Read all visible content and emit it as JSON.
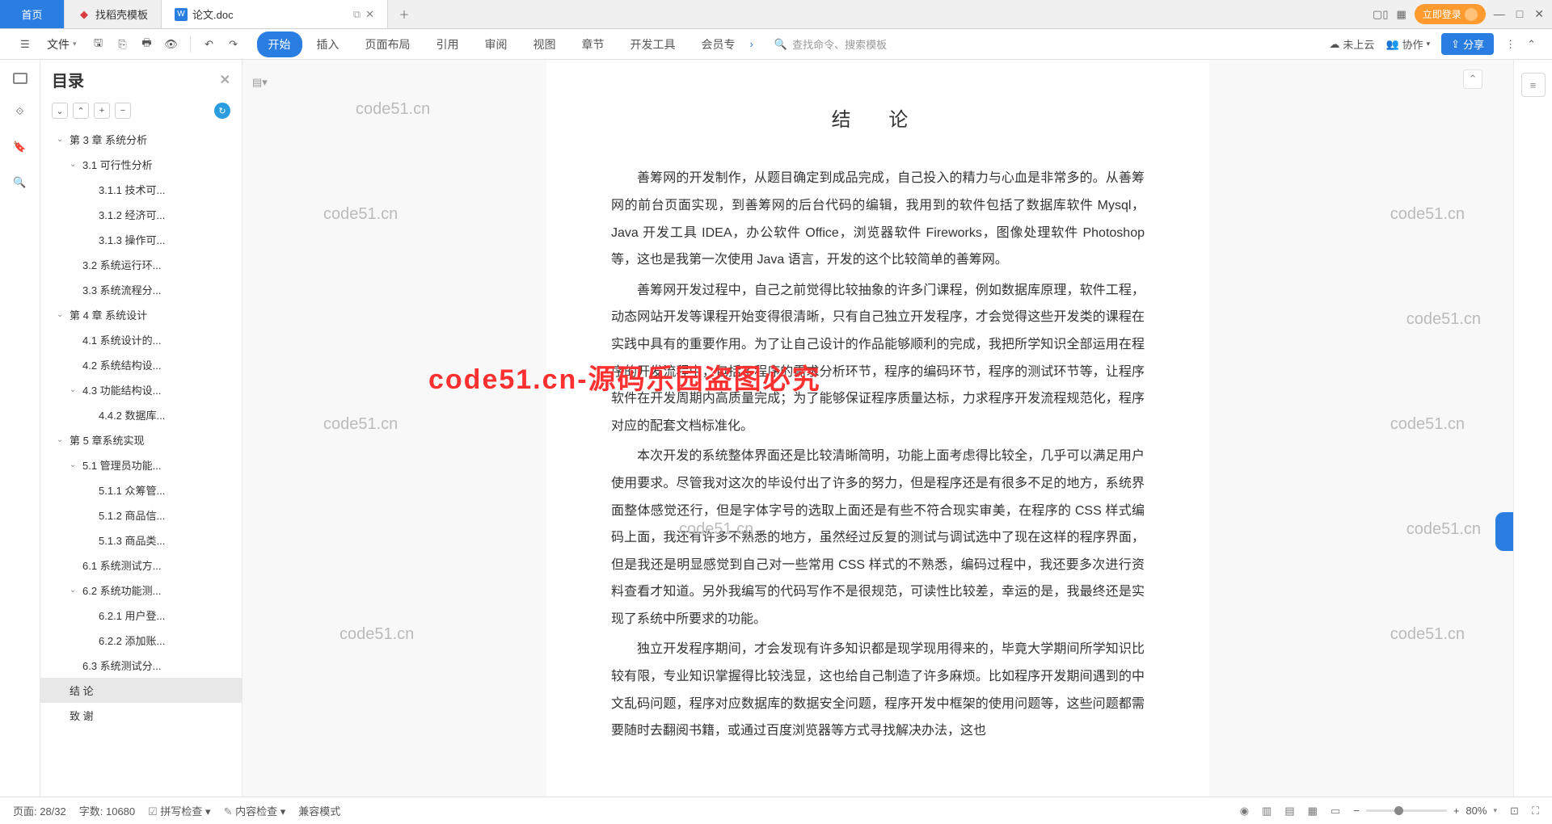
{
  "tabs": {
    "home": "首页",
    "t1": "找稻壳模板",
    "t2": "论文.doc"
  },
  "login": "立即登录",
  "file_menu": "文件",
  "ribbon_tabs": [
    "开始",
    "插入",
    "页面布局",
    "引用",
    "审阅",
    "视图",
    "章节",
    "开发工具",
    "会员专"
  ],
  "search_placeholder": "查找命令、搜索模板",
  "cloud_status": "未上云",
  "collab": "协作",
  "share": "分享",
  "toc": {
    "title": "目录",
    "items": [
      {
        "t": "第 3 章 系统分析",
        "ind": 1,
        "chev": "v"
      },
      {
        "t": "3.1 可行性分析",
        "ind": 2,
        "chev": "v"
      },
      {
        "t": "3.1.1 技术可...",
        "ind": 3
      },
      {
        "t": "3.1.2 经济可...",
        "ind": 3
      },
      {
        "t": "3.1.3 操作可...",
        "ind": 3
      },
      {
        "t": "3.2 系统运行环...",
        "ind": 2
      },
      {
        "t": "3.3 系统流程分...",
        "ind": 2
      },
      {
        "t": "第 4 章  系统设计",
        "ind": 1,
        "chev": "v"
      },
      {
        "t": "4.1 系统设计的...",
        "ind": 2
      },
      {
        "t": "4.2 系统结构设...",
        "ind": 2
      },
      {
        "t": "4.3 功能结构设...",
        "ind": 2,
        "chev": "v"
      },
      {
        "t": "4.4.2 数据库...",
        "ind": 3
      },
      {
        "t": "第 5 章系统实现",
        "ind": 1,
        "chev": "v"
      },
      {
        "t": "5.1 管理员功能...",
        "ind": 2,
        "chev": "v"
      },
      {
        "t": "5.1.1 众筹管...",
        "ind": 3
      },
      {
        "t": "5.1.2 商品信...",
        "ind": 3
      },
      {
        "t": "5.1.3 商品类...",
        "ind": 3
      },
      {
        "t": "6.1 系统测试方...",
        "ind": 2
      },
      {
        "t": "6.2 系统功能测...",
        "ind": 2,
        "chev": "v"
      },
      {
        "t": "6.2.1 用户登...",
        "ind": 3
      },
      {
        "t": "6.2.2 添加账...",
        "ind": 3
      },
      {
        "t": "6.3 系统测试分...",
        "ind": 2
      },
      {
        "t": "结  论",
        "ind": 1,
        "sel": true
      },
      {
        "t": "致  谢",
        "ind": 1
      }
    ]
  },
  "doc": {
    "title": "结    论",
    "p1": "善筹网的开发制作，从题目确定到成品完成，自己投入的精力与心血是非常多的。从善筹网的前台页面实现，到善筹网的后台代码的编辑，我用到的软件包括了数据库软件 Mysql，Java 开发工具 IDEA，办公软件 Office，浏览器软件 Fireworks，图像处理软件 Photoshop 等，这也是我第一次使用 Java 语言，开发的这个比较简单的善筹网。",
    "p2": "善筹网开发过程中，自己之前觉得比较抽象的许多门课程，例如数据库原理，软件工程，动态网站开发等课程开始变得很清晰，只有自己独立开发程序，才会觉得这些开发类的课程在实践中具有的重要作用。为了让自己设计的作品能够顺利的完成，我把所学知识全部运用在程序的开发流程中，包括了程序的需求分析环节，程序的编码环节，程序的测试环节等，让程序软件在开发周期内高质量完成；为了能够保证程序质量达标，力求程序开发流程规范化，程序对应的配套文档标准化。",
    "p3": "本次开发的系统整体界面还是比较清晰简明，功能上面考虑得比较全，几乎可以满足用户使用要求。尽管我对这次的毕设付出了许多的努力，但是程序还是有很多不足的地方，系统界面整体感觉还行，但是字体字号的选取上面还是有些不符合现实审美，在程序的 CSS 样式编码上面，我还有许多不熟悉的地方，虽然经过反复的测试与调试选中了现在这样的程序界面，但是我还是明显感觉到自己对一些常用 CSS 样式的不熟悉，编码过程中，我还要多次进行资料查看才知道。另外我编写的代码写作不是很规范，可读性比较差，幸运的是，我最终还是实现了系统中所要求的功能。",
    "p4": "独立开发程序期间，才会发现有许多知识都是现学现用得来的，毕竟大学期间所学知识比较有限，专业知识掌握得比较浅显，这也给自己制造了许多麻烦。比如程序开发期间遇到的中文乱码问题，程序对应数据库的数据安全问题，程序开发中框架的使用问题等，这些问题都需要随时去翻阅书籍，或通过百度浏览器等方式寻找解决办法，这也"
  },
  "status": {
    "page": "页面: 28/32",
    "words": "字数: 10680",
    "spell": "拼写检查",
    "content": "内容检查",
    "compat": "兼容模式",
    "zoom": "80%"
  },
  "watermarks": {
    "w": "code51.cn",
    "red": "code51.cn-源码乐园盗图必究"
  }
}
